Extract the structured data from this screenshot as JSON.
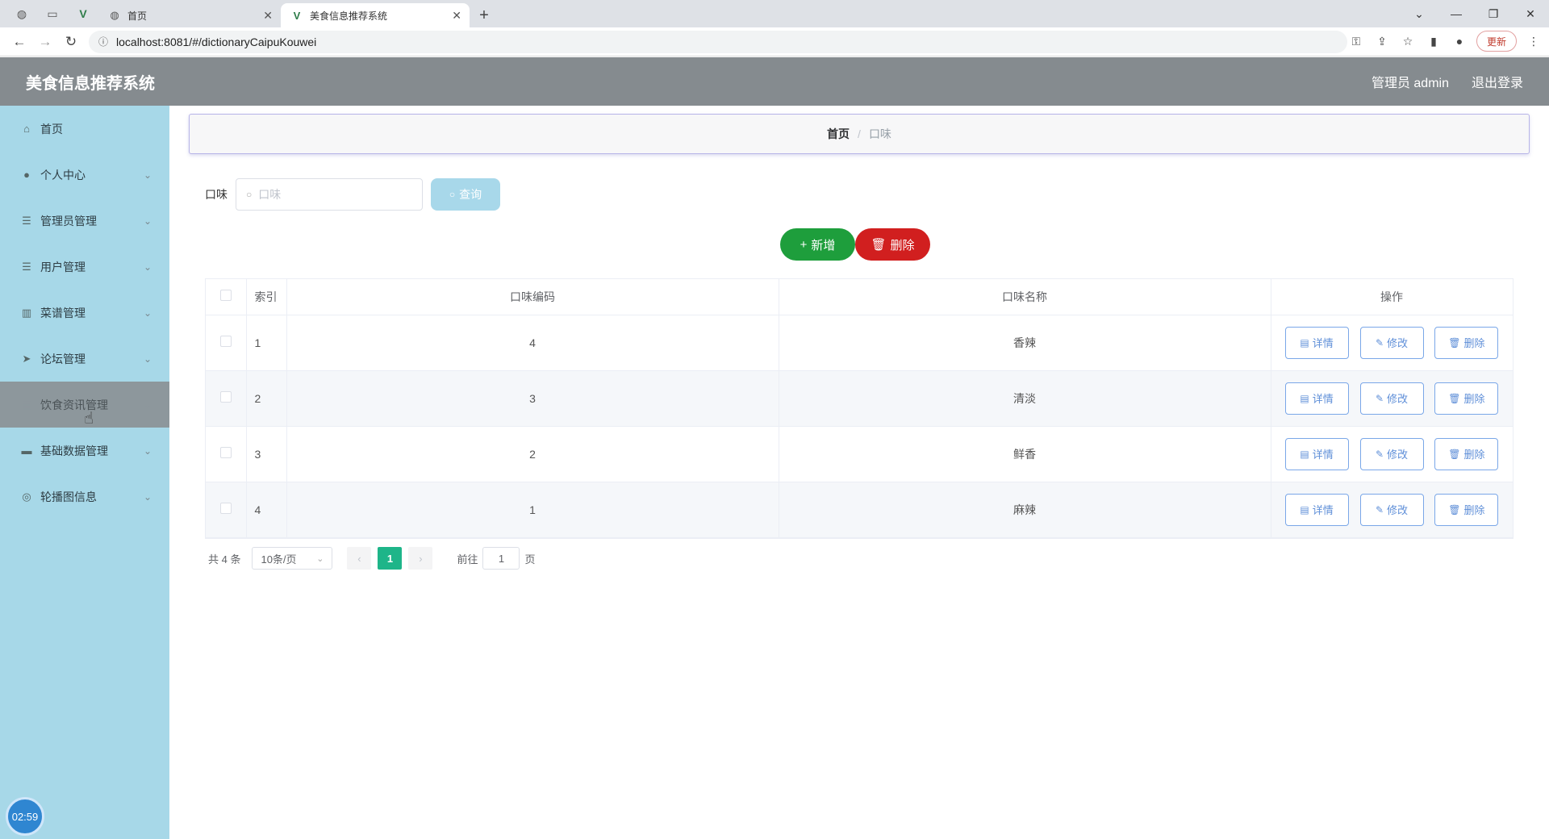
{
  "browser": {
    "tabs": [
      {
        "title": "首页",
        "active": false
      },
      {
        "title": "美食信息推荐系统",
        "active": true
      }
    ],
    "url": "localhost:8081/#/dictionaryCaipuKouwei",
    "update_label": "更新"
  },
  "header": {
    "title": "美食信息推荐系统",
    "user": "管理员 admin",
    "logout": "退出登录"
  },
  "sidebar": {
    "items": [
      {
        "label": "首页",
        "icon": "home-icon"
      },
      {
        "label": "个人中心",
        "icon": "user-icon"
      },
      {
        "label": "管理员管理",
        "icon": "list-icon"
      },
      {
        "label": "用户管理",
        "icon": "list-icon"
      },
      {
        "label": "菜谱管理",
        "icon": "chart-icon"
      },
      {
        "label": "论坛管理",
        "icon": "send-icon"
      },
      {
        "label": "饮食资讯管理",
        "icon": "doc-icon"
      },
      {
        "label": "基础数据管理",
        "icon": "monitor-icon"
      },
      {
        "label": "轮播图信息",
        "icon": "compass-icon"
      }
    ],
    "clock": "02:59"
  },
  "breadcrumb": {
    "home": "首页",
    "current": "口味"
  },
  "search": {
    "label": "口味",
    "placeholder": "口味",
    "query_label": "查询"
  },
  "actions": {
    "add_label": "新增",
    "delete_label": "删除"
  },
  "table": {
    "headers": {
      "index": "索引",
      "code": "口味编码",
      "name": "口味名称",
      "ops": "操作"
    },
    "ops": {
      "detail": "详情",
      "edit": "修改",
      "delete": "删除"
    },
    "rows": [
      {
        "index": "1",
        "code": "4",
        "name": "香辣"
      },
      {
        "index": "2",
        "code": "3",
        "name": "清淡"
      },
      {
        "index": "3",
        "code": "2",
        "name": "鲜香"
      },
      {
        "index": "4",
        "code": "1",
        "name": "麻辣"
      }
    ]
  },
  "pagination": {
    "total": "共 4 条",
    "page_size": "10条/页",
    "current": "1",
    "goto_prefix": "前往",
    "goto_value": "1",
    "goto_suffix": "页"
  }
}
